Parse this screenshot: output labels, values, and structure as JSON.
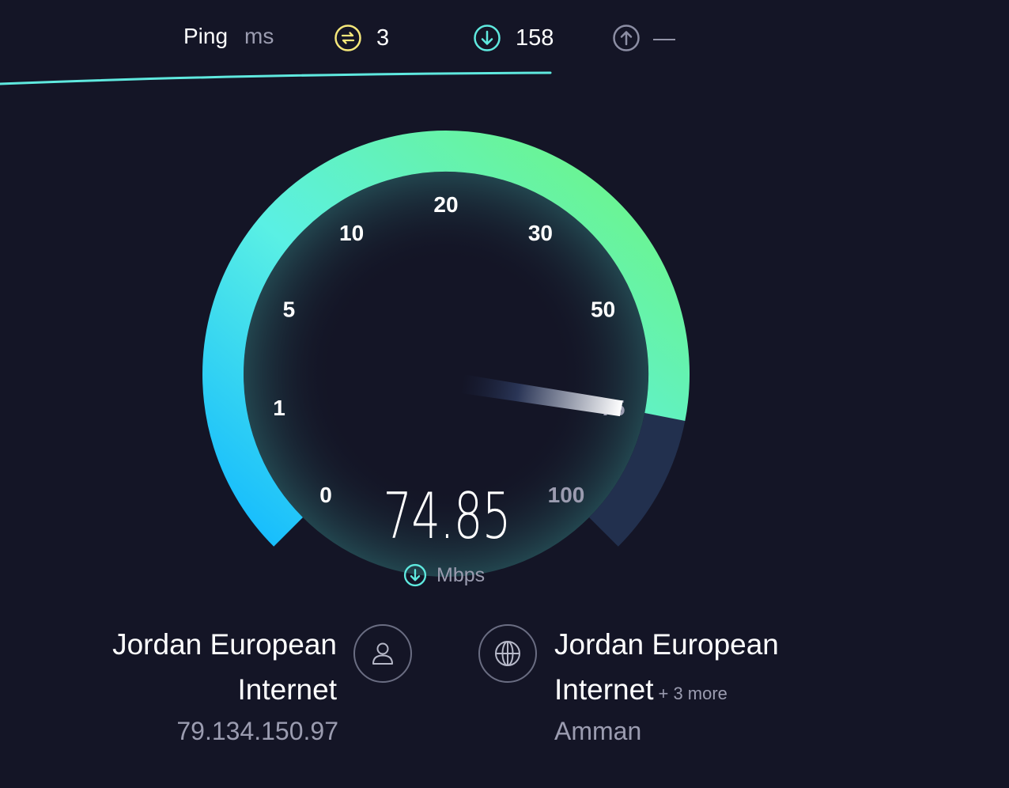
{
  "header": {
    "ping_label": "Ping",
    "ping_unit": "ms",
    "jitter_value": "3",
    "download_value": "158",
    "upload_value": "—"
  },
  "gauge": {
    "ticks": [
      "0",
      "1",
      "5",
      "10",
      "20",
      "30",
      "50",
      "75",
      "100"
    ],
    "current_value": 74.85,
    "display_value": "74.85",
    "unit": "Mbps"
  },
  "client": {
    "isp_line1": "Jordan European",
    "isp_line2": "Internet",
    "ip": "79.134.150.97"
  },
  "server": {
    "name_line1": "Jordan European",
    "name_line2": "Internet",
    "more": "+ 3 more",
    "city": "Amman"
  },
  "icons": {
    "jitter": "jitter-icon",
    "download": "download-icon",
    "upload": "upload-icon",
    "user": "user-icon",
    "globe": "globe-icon"
  },
  "colors": {
    "background": "#141526",
    "gauge_start": "#12b9ff",
    "gauge_mid": "#5af0e4",
    "gauge_end": "#6ff57e",
    "gauge_track": "#22304e",
    "jitter_icon": "#f5e77a",
    "download_icon": "#5fe9df",
    "upload_icon": "#8c8ea4"
  }
}
